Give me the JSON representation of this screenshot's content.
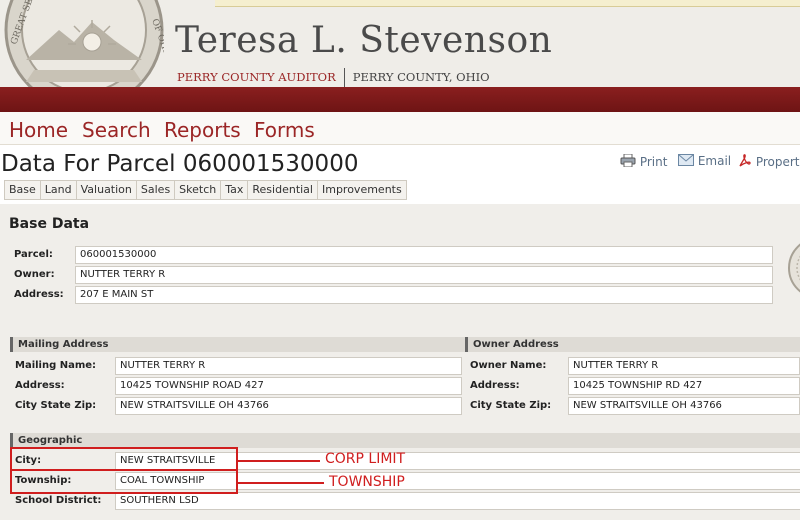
{
  "header": {
    "name": "Teresa L. Stevenson",
    "office": "PERRY COUNTY AUDITOR",
    "county": "PERRY COUNTY, OHIO"
  },
  "nav": {
    "home": "Home",
    "search": "Search",
    "reports": "Reports",
    "forms": "Forms"
  },
  "page": {
    "title": "Data For Parcel 060001530000",
    "actions": {
      "print": "Print",
      "email": "Email",
      "property": "Property"
    }
  },
  "tabs": [
    "Base",
    "Land",
    "Valuation",
    "Sales",
    "Sketch",
    "Tax",
    "Residential",
    "Improvements"
  ],
  "base_data": {
    "heading": "Base Data",
    "parcel_label": "Parcel:",
    "parcel": "060001530000",
    "owner_label": "Owner:",
    "owner": "NUTTER TERRY R",
    "address_label": "Address:",
    "address": "207 E MAIN ST"
  },
  "mailing": {
    "heading": "Mailing Address",
    "name_label": "Mailing Name:",
    "name": "NUTTER TERRY R",
    "address_label": "Address:",
    "address": "10425 TOWNSHIP ROAD 427",
    "csz_label": "City State Zip:",
    "csz": "NEW STRAITSVILLE OH 43766"
  },
  "owner_address": {
    "heading": "Owner Address",
    "name_label": "Owner Name:",
    "name": "NUTTER TERRY R",
    "address_label": "Address:",
    "address": "10425 TOWNSHIP RD 427",
    "csz_label": "City State Zip:",
    "csz": "NEW STRAITSVILLE OH 43766"
  },
  "geographic": {
    "heading": "Geographic",
    "city_label": "City:",
    "city": "NEW STRAITSVILLE",
    "township_label": "Township:",
    "township": "COAL TOWNSHIP",
    "school_label": "School District:",
    "school": "SOUTHERN LSD"
  },
  "annotations": {
    "corp_limit": "CORP LIMIT",
    "township": "TOWNSHIP"
  },
  "colors": {
    "brand_red": "#8a1f1f",
    "nav_text": "#9b2626",
    "annotation_red": "#d01e1e"
  }
}
